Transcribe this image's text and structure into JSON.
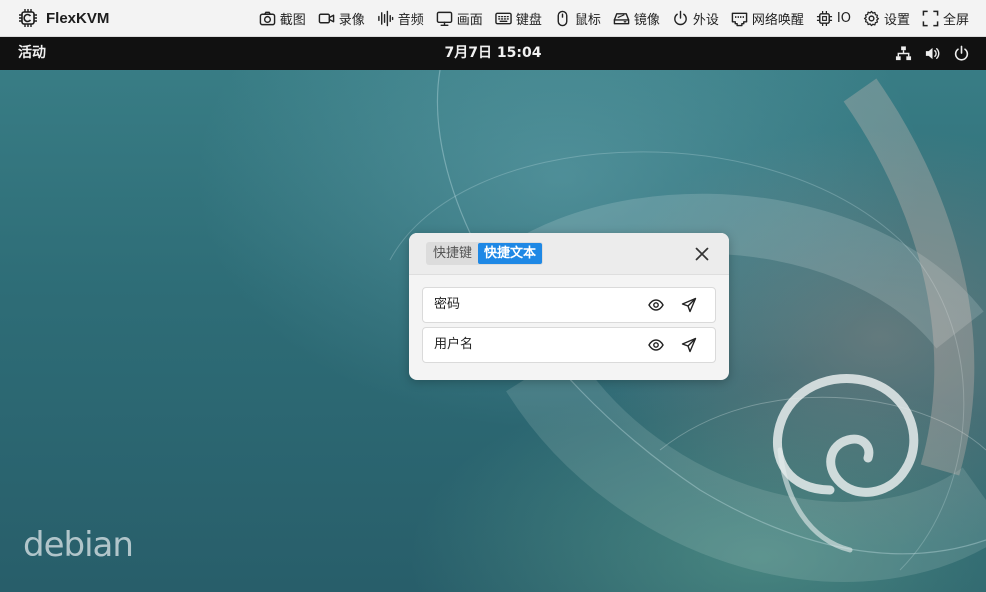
{
  "toolbar": {
    "brand": "FlexKVM",
    "items": [
      {
        "id": "screenshot",
        "label": "截图",
        "icon": "camera-icon"
      },
      {
        "id": "record",
        "label": "录像",
        "icon": "video-camera-icon"
      },
      {
        "id": "audio",
        "label": "音频",
        "icon": "audio-wave-icon"
      },
      {
        "id": "display",
        "label": "画面",
        "icon": "monitor-icon"
      },
      {
        "id": "keyboard",
        "label": "键盘",
        "icon": "keyboard-icon"
      },
      {
        "id": "mouse",
        "label": "鼠标",
        "icon": "mouse-icon"
      },
      {
        "id": "mirror",
        "label": "镜像",
        "icon": "disk-drive-icon"
      },
      {
        "id": "peripheral",
        "label": "外设",
        "icon": "power-icon"
      },
      {
        "id": "wol",
        "label": "网络唤醒",
        "icon": "ethernet-port-icon"
      },
      {
        "id": "io",
        "label": "IO",
        "icon": "chip-icon"
      },
      {
        "id": "settings",
        "label": "设置",
        "icon": "gear-icon"
      },
      {
        "id": "fullscreen",
        "label": "全屏",
        "icon": "fullscreen-icon"
      }
    ]
  },
  "desktop": {
    "activities": "活动",
    "clock": "7月7日  15:04",
    "tray": [
      "network-icon",
      "volume-icon",
      "power-icon"
    ],
    "logo_text": "debian"
  },
  "quick_panel": {
    "tabs": [
      {
        "label": "快捷键",
        "active": false
      },
      {
        "label": "快捷文本",
        "active": true
      }
    ],
    "entries": [
      {
        "name": "密码"
      },
      {
        "name": "用户名"
      }
    ]
  },
  "colors": {
    "accent": "#1e88e5",
    "toolbar_bg": "#f3f3f3",
    "gnome_bar": "#111111"
  }
}
